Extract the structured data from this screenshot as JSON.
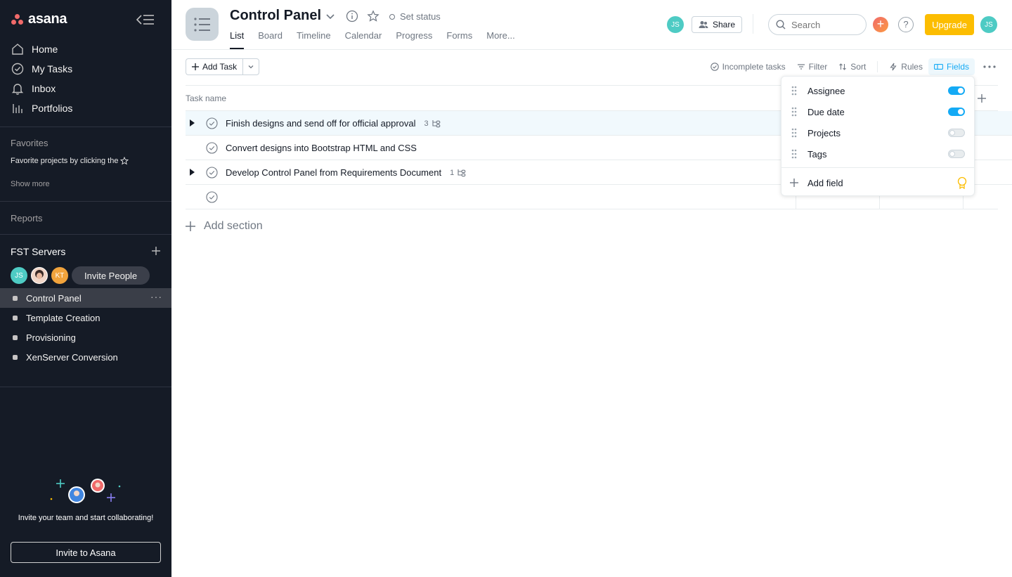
{
  "app": {
    "logo": "asana"
  },
  "sidebar": {
    "nav": [
      {
        "label": "Home",
        "icon": "home-icon"
      },
      {
        "label": "My Tasks",
        "icon": "check-circle-icon"
      },
      {
        "label": "Inbox",
        "icon": "bell-icon"
      },
      {
        "label": "Portfolios",
        "icon": "bar-chart-icon"
      }
    ],
    "favorites_title": "Favorites",
    "favorites_hint": "Favorite projects by clicking the",
    "show_more": "Show more",
    "reports": "Reports",
    "team": {
      "name": "FST Servers",
      "members": [
        {
          "initials": "JS",
          "color": "#4ecbc4"
        },
        {
          "initials": "",
          "type": "photo"
        },
        {
          "initials": "KT",
          "color": "#f1a33c"
        }
      ],
      "invite_label": "Invite People"
    },
    "projects": [
      {
        "name": "Control Panel",
        "active": true
      },
      {
        "name": "Template Creation"
      },
      {
        "name": "Provisioning"
      },
      {
        "name": "XenServer Conversion"
      }
    ],
    "invite_message": "Invite your team and start collaborating!",
    "invite_button": "Invite to Asana"
  },
  "header": {
    "title": "Control Panel",
    "set_status": "Set status",
    "tabs": [
      "List",
      "Board",
      "Timeline",
      "Calendar",
      "Progress",
      "Forms",
      "More..."
    ],
    "active_tab": "List",
    "member_initials": "JS",
    "share_label": "Share",
    "search_placeholder": "Search",
    "help_label": "?",
    "upgrade_label": "Upgrade",
    "user_initials": "JS"
  },
  "toolbar": {
    "add_task": "Add Task",
    "incomplete": "Incomplete tasks",
    "filter": "Filter",
    "sort": "Sort",
    "rules": "Rules",
    "fields": "Fields"
  },
  "list": {
    "column_task": "Task name",
    "tasks": [
      {
        "name": "Finish designs and send off for official approval",
        "subtasks": "3",
        "expandable": true,
        "highlighted": true
      },
      {
        "name": "Convert designs into Bootstrap HTML and CSS",
        "subtasks": "",
        "expandable": false
      },
      {
        "name": "Develop Control Panel from Requirements Document",
        "subtasks": "1",
        "expandable": true
      },
      {
        "name": "",
        "subtasks": "",
        "expandable": false
      }
    ],
    "add_section": "Add section"
  },
  "fields_menu": {
    "fields": [
      {
        "label": "Assignee",
        "enabled": true
      },
      {
        "label": "Due date",
        "enabled": true
      },
      {
        "label": "Projects",
        "enabled": false
      },
      {
        "label": "Tags",
        "enabled": false
      }
    ],
    "add_field": "Add field"
  },
  "colors": {
    "sidebar_bg": "#151b26",
    "accent_blue": "#14aaf5",
    "upgrade_yellow": "#fcbd01",
    "brand_coral": "#f06a6a"
  }
}
